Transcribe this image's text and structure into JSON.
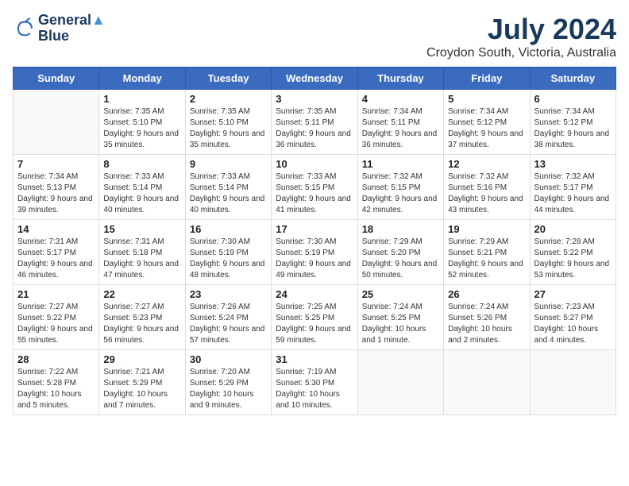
{
  "logo": {
    "line1": "General",
    "line2": "Blue"
  },
  "title": "July 2024",
  "location": "Croydon South, Victoria, Australia",
  "days_of_week": [
    "Sunday",
    "Monday",
    "Tuesday",
    "Wednesday",
    "Thursday",
    "Friday",
    "Saturday"
  ],
  "weeks": [
    [
      {
        "day": "",
        "sunrise": "",
        "sunset": "",
        "daylight": ""
      },
      {
        "day": "1",
        "sunrise": "7:35 AM",
        "sunset": "5:10 PM",
        "daylight": "9 hours and 35 minutes."
      },
      {
        "day": "2",
        "sunrise": "7:35 AM",
        "sunset": "5:10 PM",
        "daylight": "9 hours and 35 minutes."
      },
      {
        "day": "3",
        "sunrise": "7:35 AM",
        "sunset": "5:11 PM",
        "daylight": "9 hours and 36 minutes."
      },
      {
        "day": "4",
        "sunrise": "7:34 AM",
        "sunset": "5:11 PM",
        "daylight": "9 hours and 36 minutes."
      },
      {
        "day": "5",
        "sunrise": "7:34 AM",
        "sunset": "5:12 PM",
        "daylight": "9 hours and 37 minutes."
      },
      {
        "day": "6",
        "sunrise": "7:34 AM",
        "sunset": "5:12 PM",
        "daylight": "9 hours and 38 minutes."
      }
    ],
    [
      {
        "day": "7",
        "sunrise": "7:34 AM",
        "sunset": "5:13 PM",
        "daylight": "9 hours and 39 minutes."
      },
      {
        "day": "8",
        "sunrise": "7:33 AM",
        "sunset": "5:14 PM",
        "daylight": "9 hours and 40 minutes."
      },
      {
        "day": "9",
        "sunrise": "7:33 AM",
        "sunset": "5:14 PM",
        "daylight": "9 hours and 40 minutes."
      },
      {
        "day": "10",
        "sunrise": "7:33 AM",
        "sunset": "5:15 PM",
        "daylight": "9 hours and 41 minutes."
      },
      {
        "day": "11",
        "sunrise": "7:32 AM",
        "sunset": "5:15 PM",
        "daylight": "9 hours and 42 minutes."
      },
      {
        "day": "12",
        "sunrise": "7:32 AM",
        "sunset": "5:16 PM",
        "daylight": "9 hours and 43 minutes."
      },
      {
        "day": "13",
        "sunrise": "7:32 AM",
        "sunset": "5:17 PM",
        "daylight": "9 hours and 44 minutes."
      }
    ],
    [
      {
        "day": "14",
        "sunrise": "7:31 AM",
        "sunset": "5:17 PM",
        "daylight": "9 hours and 46 minutes."
      },
      {
        "day": "15",
        "sunrise": "7:31 AM",
        "sunset": "5:18 PM",
        "daylight": "9 hours and 47 minutes."
      },
      {
        "day": "16",
        "sunrise": "7:30 AM",
        "sunset": "5:19 PM",
        "daylight": "9 hours and 48 minutes."
      },
      {
        "day": "17",
        "sunrise": "7:30 AM",
        "sunset": "5:19 PM",
        "daylight": "9 hours and 49 minutes."
      },
      {
        "day": "18",
        "sunrise": "7:29 AM",
        "sunset": "5:20 PM",
        "daylight": "9 hours and 50 minutes."
      },
      {
        "day": "19",
        "sunrise": "7:29 AM",
        "sunset": "5:21 PM",
        "daylight": "9 hours and 52 minutes."
      },
      {
        "day": "20",
        "sunrise": "7:28 AM",
        "sunset": "5:22 PM",
        "daylight": "9 hours and 53 minutes."
      }
    ],
    [
      {
        "day": "21",
        "sunrise": "7:27 AM",
        "sunset": "5:22 PM",
        "daylight": "9 hours and 55 minutes."
      },
      {
        "day": "22",
        "sunrise": "7:27 AM",
        "sunset": "5:23 PM",
        "daylight": "9 hours and 56 minutes."
      },
      {
        "day": "23",
        "sunrise": "7:26 AM",
        "sunset": "5:24 PM",
        "daylight": "9 hours and 57 minutes."
      },
      {
        "day": "24",
        "sunrise": "7:25 AM",
        "sunset": "5:25 PM",
        "daylight": "9 hours and 59 minutes."
      },
      {
        "day": "25",
        "sunrise": "7:24 AM",
        "sunset": "5:25 PM",
        "daylight": "10 hours and 1 minute."
      },
      {
        "day": "26",
        "sunrise": "7:24 AM",
        "sunset": "5:26 PM",
        "daylight": "10 hours and 2 minutes."
      },
      {
        "day": "27",
        "sunrise": "7:23 AM",
        "sunset": "5:27 PM",
        "daylight": "10 hours and 4 minutes."
      }
    ],
    [
      {
        "day": "28",
        "sunrise": "7:22 AM",
        "sunset": "5:28 PM",
        "daylight": "10 hours and 5 minutes."
      },
      {
        "day": "29",
        "sunrise": "7:21 AM",
        "sunset": "5:29 PM",
        "daylight": "10 hours and 7 minutes."
      },
      {
        "day": "30",
        "sunrise": "7:20 AM",
        "sunset": "5:29 PM",
        "daylight": "10 hours and 9 minutes."
      },
      {
        "day": "31",
        "sunrise": "7:19 AM",
        "sunset": "5:30 PM",
        "daylight": "10 hours and 10 minutes."
      },
      {
        "day": "",
        "sunrise": "",
        "sunset": "",
        "daylight": ""
      },
      {
        "day": "",
        "sunrise": "",
        "sunset": "",
        "daylight": ""
      },
      {
        "day": "",
        "sunrise": "",
        "sunset": "",
        "daylight": ""
      }
    ]
  ]
}
